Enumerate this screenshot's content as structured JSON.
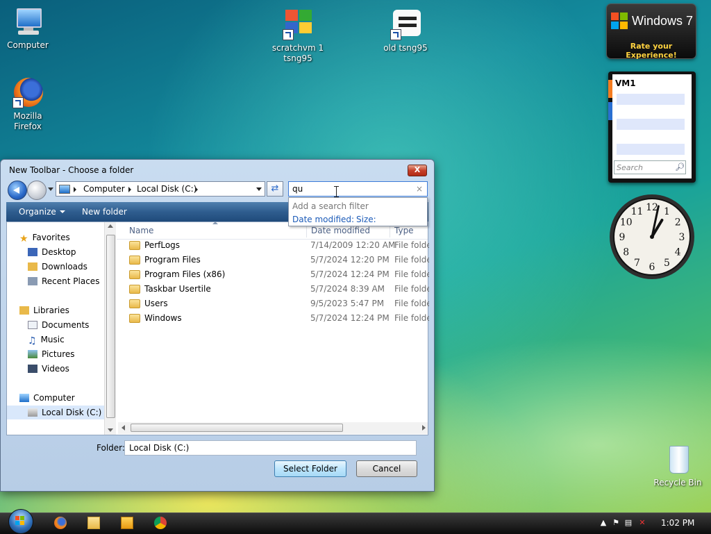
{
  "desktop": {
    "icons": [
      {
        "label": "Computer",
        "icon": "computer-icon"
      },
      {
        "label": "Mozilla Firefox",
        "icon": "firefox-icon"
      },
      {
        "label": "scratchvm 1 tsng95",
        "icon": "scratch-shortcut-icon"
      },
      {
        "label": "old tsng95",
        "icon": "shortcut-icon"
      },
      {
        "label": "Recycle Bin",
        "icon": "recycle-bin-icon"
      }
    ]
  },
  "gadgets": {
    "win7": {
      "title": "Windows 7",
      "link": "Rate your Experience!"
    },
    "notes": {
      "title": "VM1",
      "search_placeholder": "Search"
    },
    "clock": {
      "hour": 1,
      "minute": 2,
      "numerals": [
        "12",
        "1",
        "2",
        "3",
        "4",
        "5",
        "6",
        "7",
        "8",
        "9",
        "10",
        "11"
      ]
    }
  },
  "dialog": {
    "title": "New Toolbar - Choose a folder",
    "close": "X",
    "address": {
      "crumbs": [
        "Computer",
        "Local Disk (C:)"
      ]
    },
    "search": {
      "value": "qu",
      "clear": "×",
      "suggest_header": "Add a search filter",
      "filters": [
        "Date modified:",
        "Size:"
      ]
    },
    "toolbar": {
      "organize": "Organize",
      "new_folder": "New folder"
    },
    "nav": {
      "favorites_header": "Favorites",
      "favorites": [
        "Desktop",
        "Downloads",
        "Recent Places"
      ],
      "libraries_header": "Libraries",
      "libraries": [
        "Documents",
        "Music",
        "Pictures",
        "Videos"
      ],
      "computer_header": "Computer",
      "computer": [
        "Local Disk (C:)"
      ]
    },
    "columns": [
      "Name",
      "Date modified",
      "Type"
    ],
    "files": [
      {
        "name": "PerfLogs",
        "date": "7/14/2009 12:20 AM",
        "type": "File folder"
      },
      {
        "name": "Program Files",
        "date": "5/7/2024 12:20 PM",
        "type": "File folder"
      },
      {
        "name": "Program Files (x86)",
        "date": "5/7/2024 12:24 PM",
        "type": "File folder"
      },
      {
        "name": "Taskbar Usertile",
        "date": "5/7/2024 8:39 AM",
        "type": "File folder"
      },
      {
        "name": "Users",
        "date": "9/5/2023 5:47 PM",
        "type": "File folder"
      },
      {
        "name": "Windows",
        "date": "5/7/2024 12:24 PM",
        "type": "File folder"
      }
    ],
    "folder_label": "Folder:",
    "folder_value": "Local Disk (C:)",
    "select_button": "Select Folder",
    "cancel_button": "Cancel"
  },
  "taskbar": {
    "time": "1:02 PM"
  }
}
